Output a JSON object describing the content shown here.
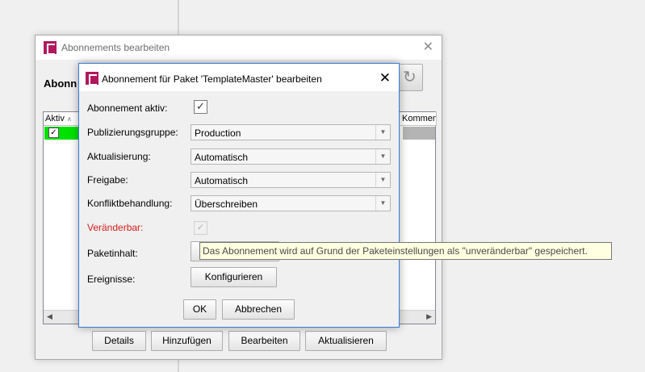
{
  "outer_window": {
    "title": "Abonnements bearbeiten",
    "close_icon": "close-icon",
    "heading": "Abonn",
    "refresh_icon": "refresh-icon",
    "table": {
      "columns": [
        "Aktiv",
        "Kommen"
      ],
      "sort_indicator": "∧",
      "rows": [
        {
          "active": true
        }
      ]
    },
    "buttons": {
      "details": "Details",
      "add": "Hinzufügen",
      "edit": "Bearbeiten",
      "update": "Aktualisieren"
    }
  },
  "dialog": {
    "title": "Abonnement für Paket 'TemplateMaster' bearbeiten",
    "fields": {
      "active_label": "Abonnement aktiv:",
      "active_value": true,
      "group_label": "Publizierungsgruppe:",
      "group_value": "Production",
      "update_label": "Aktualisierung:",
      "update_value": "Automatisch",
      "release_label": "Freigabe:",
      "release_value": "Automatisch",
      "conflict_label": "Konfliktbehandlung:",
      "conflict_value": "Überschreiben",
      "changeable_label": "Veränderbar:",
      "changeable_value": true,
      "content_label": "Paketinhalt:",
      "events_label": "Ereignisse:",
      "configure_button": "Konfigurieren"
    },
    "buttons": {
      "ok": "OK",
      "cancel": "Abbrechen"
    }
  },
  "tooltip": "Das Abonnement wird auf Grund der Paketeinstellungen als \"unveränderbar\" gespeichert.",
  "colors": {
    "brand": "#b0185f",
    "active_row": "#00e100",
    "warning_label": "#d21f1f",
    "tooltip_bg": "#ffffe1"
  }
}
